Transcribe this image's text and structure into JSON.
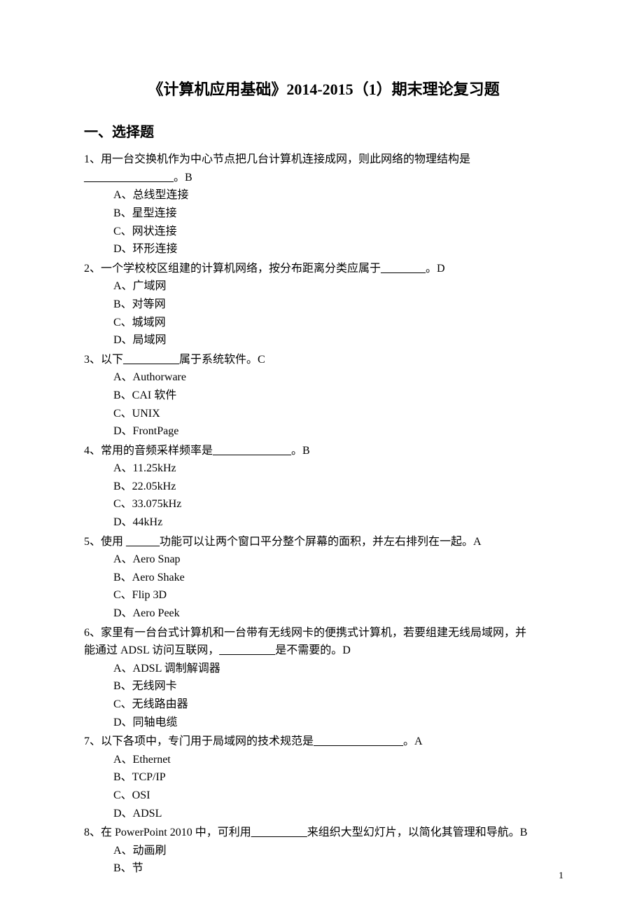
{
  "title": "《计算机应用基础》2014-2015（1）期末理论复习题",
  "section_heading": "一、选择题",
  "questions": [
    {
      "num": "1、",
      "stem_line1": "用一台交换机作为中心节点把几台计算机连接成网，则此网络的物理结构是",
      "stem_line2_blank": "________________",
      "stem_line2_tail": "。B",
      "options": [
        "A、总线型连接",
        "B、星型连接",
        "C、网状连接",
        "D、环形连接"
      ]
    },
    {
      "num": "2、",
      "stem_pre": "一个学校校区组建的计算机网络，按分布距离分类应属于",
      "blank": "________",
      "stem_post": "。D",
      "options": [
        "A、广域网",
        "B、对等网",
        "C、城域网",
        "D、局域网"
      ]
    },
    {
      "num": "3、",
      "stem_pre": "以下",
      "blank": "__________",
      "stem_post": "属于系统软件。C",
      "options": [
        "A、Authorware",
        "B、CAI 软件",
        "C、UNIX",
        "D、FrontPage"
      ]
    },
    {
      "num": "4、",
      "stem_pre": "常用的音频采样频率是",
      "blank": "______________",
      "stem_post": "。B",
      "options": [
        "A、11.25kHz",
        "B、22.05kHz",
        "C、33.075kHz",
        "D、44kHz"
      ]
    },
    {
      "num": "5、",
      "stem_pre": "使用 ",
      "blank": "______",
      "stem_post": "功能可以让两个窗口平分整个屏幕的面积，并左右排列在一起。A",
      "options": [
        "A、Aero Snap",
        "B、Aero Shake",
        "C、Flip 3D",
        "D、Aero Peek"
      ]
    },
    {
      "num": "6、",
      "stem_line1": "家里有一台台式计算机和一台带有无线网卡的便携式计算机，若要组建无线局域网，并",
      "stem_line2_pre": "能通过 ADSL 访问互联网，",
      "stem_line2_blank": "__________",
      "stem_line2_post": "是不需要的。D",
      "options": [
        "A、ADSL 调制解调器",
        "B、无线网卡",
        "C、无线路由器",
        "D、同轴电缆"
      ]
    },
    {
      "num": "7、",
      "stem_pre": "以下各项中，专门用于局域网的技术规范是",
      "blank": "________________",
      "stem_post": "。A",
      "options": [
        "A、Ethernet",
        "B、TCP/IP",
        "C、OSI",
        "D、ADSL"
      ]
    },
    {
      "num": "8、",
      "stem_pre": "在 PowerPoint 2010 中，可利用",
      "blank": "__________",
      "stem_post": "来组织大型幻灯片，以简化其管理和导航。B",
      "options": [
        "A、动画刷",
        "B、节"
      ]
    }
  ],
  "page_number": "1"
}
